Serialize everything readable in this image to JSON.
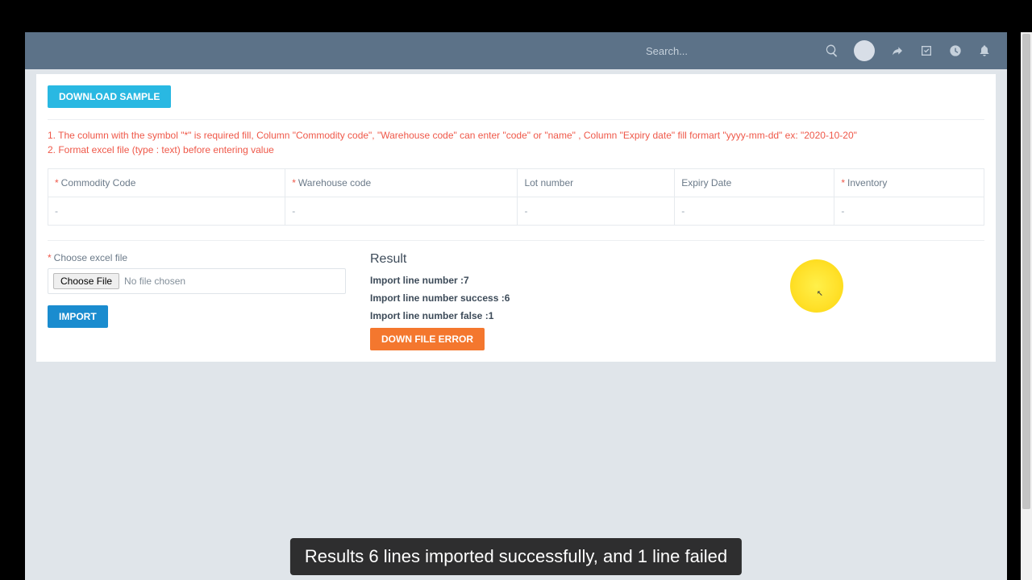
{
  "header": {
    "search_placeholder": "Search..."
  },
  "buttons": {
    "download_sample": "DOWNLOAD SAMPLE",
    "import": "IMPORT",
    "down_file_error": "DOWN FILE ERROR"
  },
  "notes": {
    "line1": "1. The column with the symbol \"*\" is required fill, Column \"Commodity code\", \"Warehouse code\" can enter \"code\" or \"name\" , Column \"Expiry date\" fill formart \"yyyy-mm-dd\" ex: \"2020-10-20\"",
    "line2": "2. Format excel file (type : text) before entering value"
  },
  "table": {
    "headers": {
      "commodity_code": "Commodity Code",
      "warehouse_code": "Warehouse code",
      "lot_number": "Lot number",
      "expiry_date": "Expiry Date",
      "inventory": "Inventory"
    },
    "cells": {
      "c1": "-",
      "c2": "-",
      "c3": "-",
      "c4": "-",
      "c5": "-"
    }
  },
  "file_input": {
    "label": "Choose excel file",
    "button": "Choose File",
    "status": "No file chosen"
  },
  "result": {
    "title": "Result",
    "line_number": "Import line number :7",
    "line_success": "Import line number success :6",
    "line_false": "Import line number false :1"
  },
  "caption": "Results 6 lines imported successfully, and 1 line failed"
}
